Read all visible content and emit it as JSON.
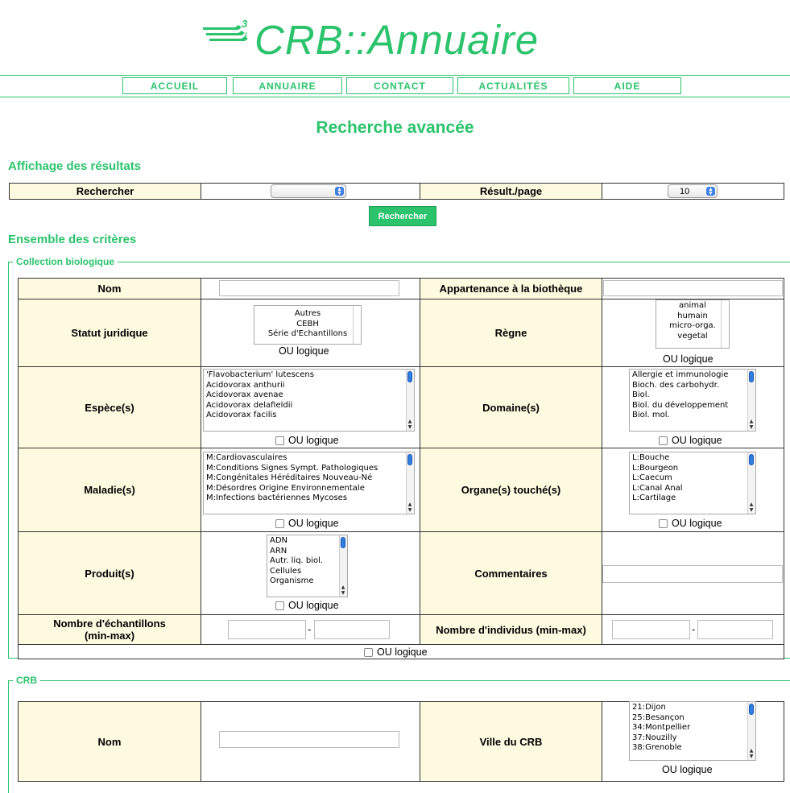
{
  "header": {
    "logo_text": "CRB::Annuaire",
    "logo_sup": "3",
    "logo_sub": "i"
  },
  "nav": [
    "ACCUEIL",
    "ANNUAIRE",
    "CONTACT",
    "ACTUALITÉS",
    "AIDE"
  ],
  "page_title": "Recherche avancée",
  "affichage": {
    "heading": "Affichage des résultats",
    "rechercher_label": "Rechercher",
    "rechercher_value": "",
    "resultpage_label": "Résult./page",
    "resultpage_value": "10",
    "search_button": "Rechercher"
  },
  "criteres_heading": "Ensemble des critères",
  "collection": {
    "legend": "Collection biologique",
    "nom_label": "Nom",
    "appartenance_label": "Appartenance à la biothèque",
    "statut_label": "Statut juridique",
    "statut_options": [
      "Autres",
      "CEBH",
      "Série d'Echantillons"
    ],
    "regne_label": "Règne",
    "regne_options": [
      "animal",
      "humain",
      "micro-orga.",
      "vegetal"
    ],
    "espece_label": "Espèce(s)",
    "espece_options": [
      "'Flavobacterium' lutescens",
      "Acidovorax anthurii",
      "Acidovorax avenae",
      "Acidovorax delafieldii",
      "Acidovorax facilis"
    ],
    "domaine_label": "Domaine(s)",
    "domaine_options": [
      "Allergie et immunologie",
      "Bioch. des carbohydr.",
      "Biol.",
      "Biol. du développement",
      "Biol. mol."
    ],
    "maladie_label": "Maladie(s)",
    "maladie_options": [
      "M:Cardiovasculaires",
      "M:Conditions Signes Sympt. Pathologiques",
      "M:Congénitales Héréditaires Nouveau-Né",
      "M:Désordres Origine Environnementale",
      "M:Infections bactériennes Mycoses"
    ],
    "organe_label": "Organe(s) touché(s)",
    "organe_options": [
      "L:Bouche",
      "L:Bourgeon",
      "L:Caecum",
      "L:Canal Anal",
      "L:Cartilage"
    ],
    "produit_label": "Produit(s)",
    "produit_options": [
      "ADN",
      "ARN",
      "Autr. liq. biol.",
      "Cellules",
      "Organisme"
    ],
    "commentaires_label": "Commentaires",
    "nb_echantillons_label_1": "Nombre d'échantillons",
    "nb_echantillons_label_2": "(min-max)",
    "nb_individus_label": "Nombre d'individus (min-max)",
    "dash": "-",
    "ou_logique": "OU logique"
  },
  "crb": {
    "legend": "CRB",
    "nom_label": "Nom",
    "ville_label": "Ville du CRB",
    "ville_options": [
      "21:Dijon",
      "25:Besançon",
      "34:Montpellier",
      "37:Nouzilly",
      "38:Grenoble"
    ],
    "ou_logique": "OU logique"
  },
  "colors": {
    "accent": "#2bc36c",
    "label_bg": "#fdfae0"
  }
}
